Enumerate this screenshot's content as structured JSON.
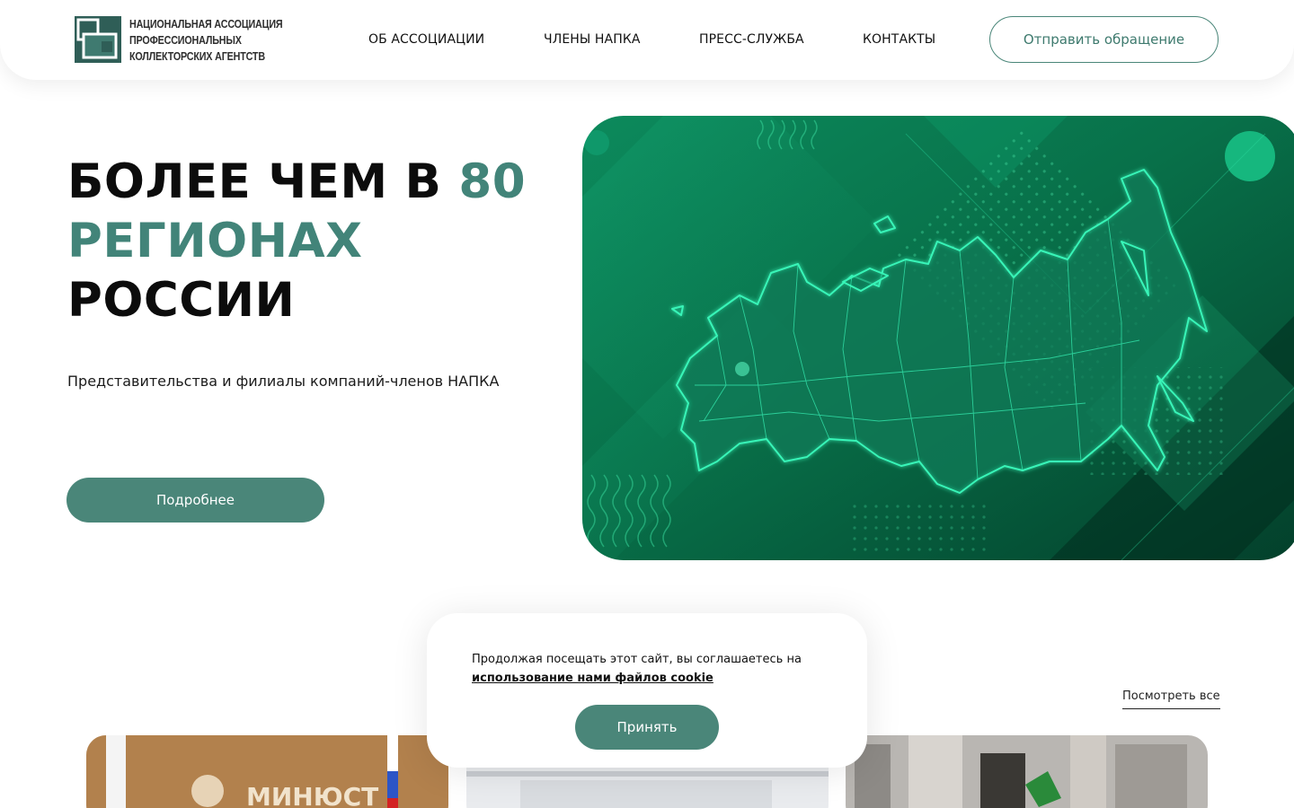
{
  "header": {
    "logo_lines": [
      "НАЦИОНАЛЬНАЯ АССОЦИАЦИЯ",
      "ПРОФЕССИОНАЛЬНЫХ",
      "КОЛЛЕКТОРСКИХ АГЕНТСТВ"
    ],
    "nav": [
      "ОБ АССОЦИАЦИИ",
      "ЧЛЕНЫ НАПКА",
      "ПРЕСС-СЛУЖБА",
      "КОНТАКТЫ"
    ],
    "cta_label": "Отправить обращение"
  },
  "hero": {
    "title_part1": "БОЛЕЕ ЧЕМ В ",
    "title_highlight1": "80",
    "title_highlight2": "РЕГИОНАХ",
    "title_part3": "РОССИИ",
    "subtitle": "Представительства и филиалы компаний-членов НАПКА",
    "button_label": "Подробнее",
    "slides_total": 2,
    "slide_active": 1
  },
  "news": {
    "see_all_label": "Посмотреть все",
    "card1_sign": "МИНЮСТ"
  },
  "cookie": {
    "text": "Продолжая посещать этот сайт, вы соглашаетесь на",
    "link_text": "использование нами файлов cookie",
    "accept_label": "Принять"
  },
  "colors": {
    "accent": "#4a8679",
    "accent_text": "#428479",
    "banner_dark": "#03402b",
    "banner_light": "#12a070"
  }
}
